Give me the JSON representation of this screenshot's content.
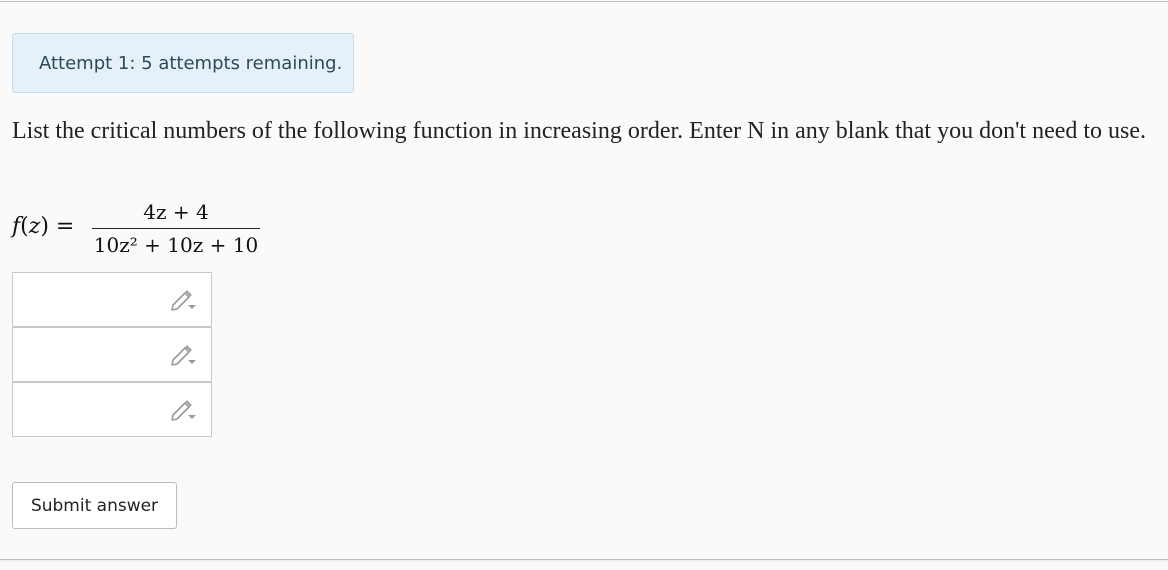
{
  "alert": {
    "text": "Attempt 1: 5 attempts remaining."
  },
  "question": {
    "text": "List the critical numbers of the following function in increasing order. Enter N in any blank that you don't need to use."
  },
  "formula": {
    "lhs_func": "f",
    "lhs_var": "z",
    "numerator": "4z + 4",
    "denominator": "10z² + 10z + 10"
  },
  "answers": [
    {
      "value": "",
      "icon": "pencil-icon"
    },
    {
      "value": "",
      "icon": "pencil-icon"
    },
    {
      "value": "",
      "icon": "pencil-icon"
    }
  ],
  "submit": {
    "label": "Submit answer"
  },
  "colors": {
    "alert_bg": "#e6f0f8",
    "alert_text": "#2b4a5a",
    "page_bg": "#fafafa",
    "input_border": "#c8c8c8"
  }
}
